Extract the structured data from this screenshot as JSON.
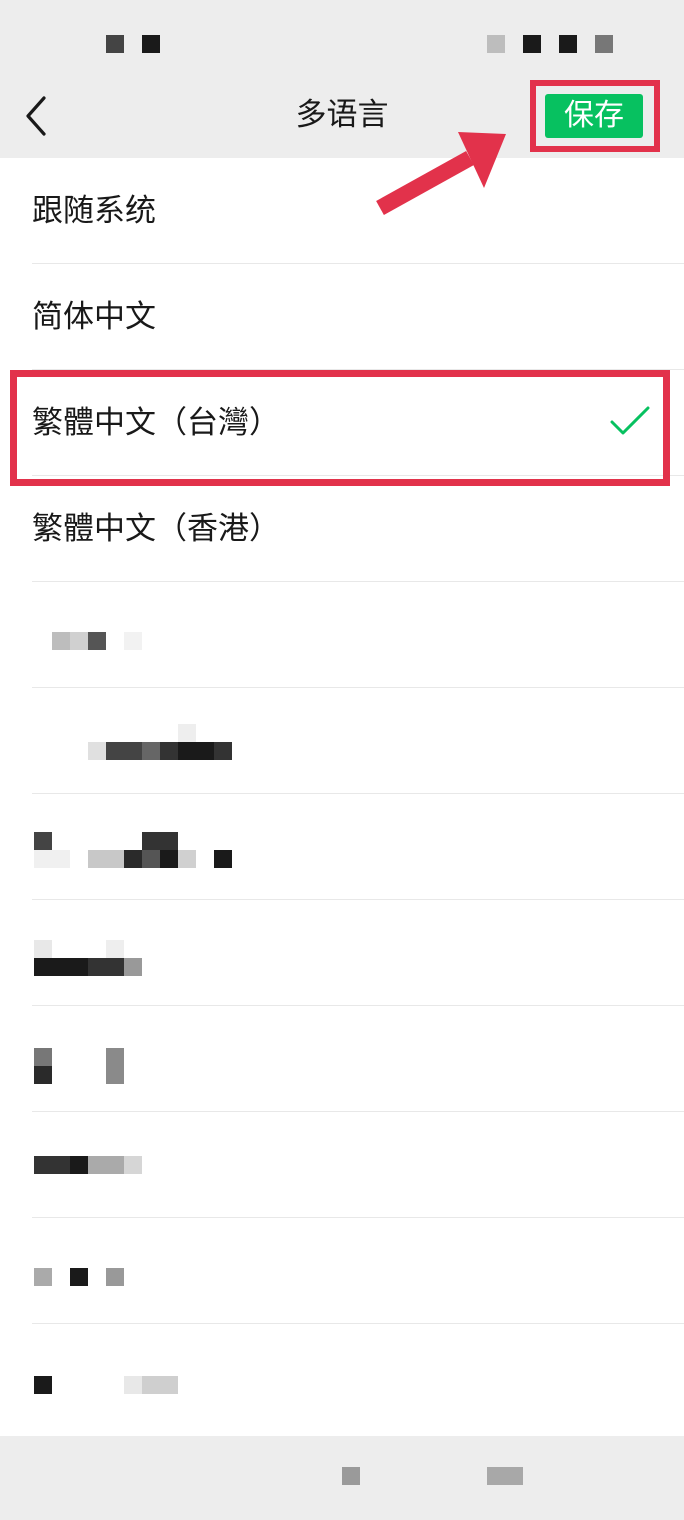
{
  "nav": {
    "title": "多语言",
    "save_label": "保存"
  },
  "languages": [
    {
      "label": "跟随系统",
      "selected": false
    },
    {
      "label": "简体中文",
      "selected": false
    },
    {
      "label": "繁體中文（台灣）",
      "selected": true
    },
    {
      "label": "繁體中文（香港）",
      "selected": false
    }
  ],
  "colors": {
    "accent": "#07c160",
    "highlight": "#e2324b",
    "background": "#ededed",
    "text": "#191919"
  },
  "icons": [
    "back-icon",
    "check-icon",
    "arrow-annotation"
  ]
}
